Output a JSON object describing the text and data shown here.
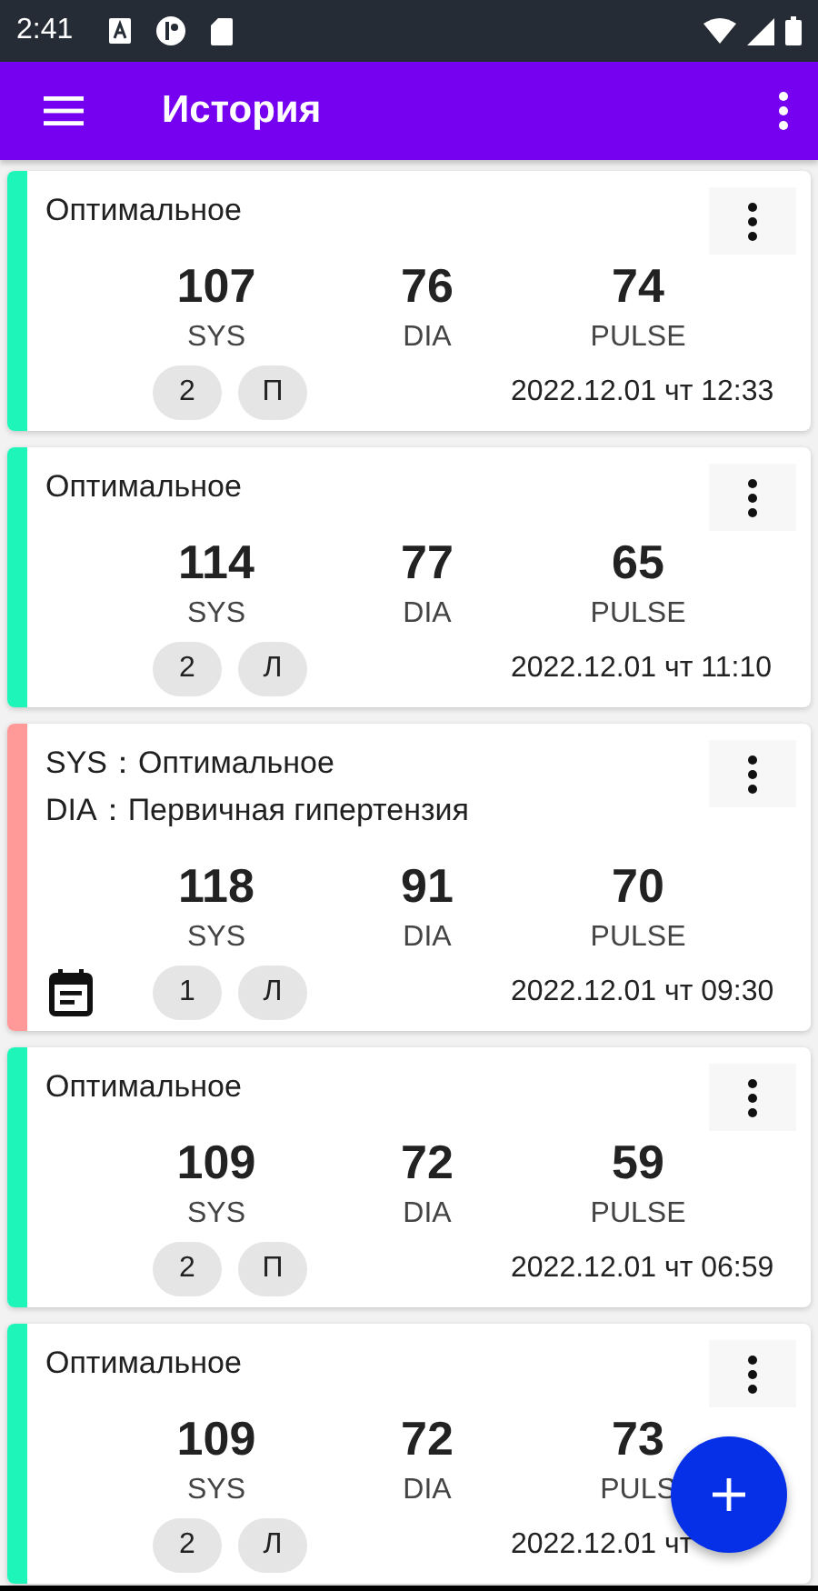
{
  "status_bar": {
    "time": "2:41"
  },
  "app_bar": {
    "title": "История"
  },
  "records": [
    {
      "color": "#1ef5b8",
      "title_lines": [
        "Оптимальное"
      ],
      "values": [
        {
          "value": "107",
          "label": "SYS"
        },
        {
          "value": "76",
          "label": "DIA"
        },
        {
          "value": "74",
          "label": "PULSE"
        }
      ],
      "has_note": false,
      "chips": [
        "2",
        "П"
      ],
      "datetime": "2022.12.01 чт 12:33"
    },
    {
      "color": "#1ef5b8",
      "title_lines": [
        "Оптимальное"
      ],
      "values": [
        {
          "value": "114",
          "label": "SYS"
        },
        {
          "value": "77",
          "label": "DIA"
        },
        {
          "value": "65",
          "label": "PULSE"
        }
      ],
      "has_note": false,
      "chips": [
        "2",
        "Л"
      ],
      "datetime": "2022.12.01 чт 11:10"
    },
    {
      "color": "#ff9a98",
      "title_lines": [
        "SYS：Оптимальное",
        "DIA：Первичная гипертензия"
      ],
      "values": [
        {
          "value": "118",
          "label": "SYS"
        },
        {
          "value": "91",
          "label": "DIA"
        },
        {
          "value": "70",
          "label": "PULSE"
        }
      ],
      "has_note": true,
      "chips": [
        "1",
        "Л"
      ],
      "datetime": "2022.12.01 чт 09:30"
    },
    {
      "color": "#1ef5b8",
      "title_lines": [
        "Оптимальное"
      ],
      "values": [
        {
          "value": "109",
          "label": "SYS"
        },
        {
          "value": "72",
          "label": "DIA"
        },
        {
          "value": "59",
          "label": "PULSE"
        }
      ],
      "has_note": false,
      "chips": [
        "2",
        "П"
      ],
      "datetime": "2022.12.01 чт 06:59"
    },
    {
      "color": "#1ef5b8",
      "title_lines": [
        "Оптимальное"
      ],
      "values": [
        {
          "value": "109",
          "label": "SYS"
        },
        {
          "value": "72",
          "label": "DIA"
        },
        {
          "value": "73",
          "label": "PULS"
        }
      ],
      "has_note": false,
      "chips": [
        "2",
        "Л"
      ],
      "datetime": "2022.12.01 чт"
    }
  ]
}
